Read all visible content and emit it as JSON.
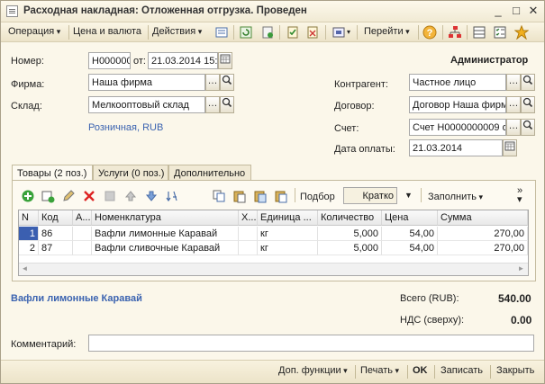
{
  "window": {
    "title": "Расходная накладная: Отложенная отгрузка. Проведен",
    "minimize": "_",
    "maximize": "□",
    "close": "✕"
  },
  "toolbar": {
    "operation": "Операция",
    "price_currency": "Цена и валюта",
    "actions": "Действия",
    "goto": "Перейти",
    "help_icon": "?"
  },
  "header": {
    "user": "Администратор",
    "number_label": "Номер:",
    "number_value": "Н000000",
    "from_label": "от:",
    "date_value": "21.03.2014 15:",
    "firm_label": "Фирма:",
    "firm_value": "Наша фирма",
    "warehouse_label": "Склад:",
    "warehouse_value": "Мелкооптовый склад",
    "price_type_link": "Розничная, RUB",
    "counterparty_label": "Контрагент:",
    "counterparty_value": "Частное лицо",
    "contract_label": "Договор:",
    "contract_value": "Договор Наша фирм",
    "invoice_label": "Счет:",
    "invoice_value": "Счет Н0000000009 о",
    "paydate_label": "Дата оплаты:",
    "paydate_value": "21.03.2014"
  },
  "tabs": [
    {
      "label": "Товары (2 поз.)"
    },
    {
      "label": "Услуги (0 поз.)"
    },
    {
      "label": "Дополнительно"
    }
  ],
  "grid_toolbar": {
    "selection": "Подбор",
    "mode": "Кратко",
    "fill": "Заполнить"
  },
  "table": {
    "columns": [
      "N",
      "Код",
      "А...",
      "Номенклатура",
      "Х...",
      "Единица ...",
      "Количество",
      "Цена",
      "Сумма"
    ],
    "rows": [
      {
        "n": "1",
        "code": "86",
        "name": "Вафли лимонные Каравай",
        "unit": "кг",
        "qty": "5,000",
        "price": "54,00",
        "sum": "270,00"
      },
      {
        "n": "2",
        "code": "87",
        "name": "Вафли сливочные Каравай",
        "unit": "кг",
        "qty": "5,000",
        "price": "54,00",
        "sum": "270,00"
      }
    ]
  },
  "summary": {
    "selected_item": "Вафли лимонные Каравай",
    "total_label": "Всего (RUB):",
    "total_value": "540.00",
    "vat_label": "НДС (сверху):",
    "vat_value": "0.00"
  },
  "comment": {
    "label": "Комментарий:",
    "value": ""
  },
  "footer": {
    "extra": "Доп. функции",
    "print": "Печать",
    "ok": "OK",
    "save": "Записать",
    "close": "Закрыть"
  }
}
